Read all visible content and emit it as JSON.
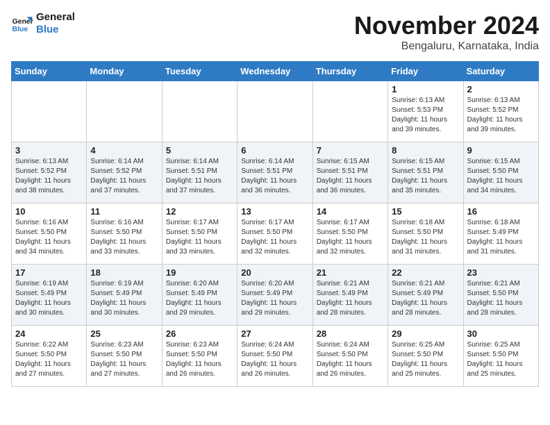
{
  "logo": {
    "line1": "General",
    "line2": "Blue"
  },
  "title": "November 2024",
  "location": "Bengaluru, Karnataka, India",
  "weekdays": [
    "Sunday",
    "Monday",
    "Tuesday",
    "Wednesday",
    "Thursday",
    "Friday",
    "Saturday"
  ],
  "weeks": [
    [
      {
        "day": "",
        "info": ""
      },
      {
        "day": "",
        "info": ""
      },
      {
        "day": "",
        "info": ""
      },
      {
        "day": "",
        "info": ""
      },
      {
        "day": "",
        "info": ""
      },
      {
        "day": "1",
        "info": "Sunrise: 6:13 AM\nSunset: 5:53 PM\nDaylight: 11 hours\nand 39 minutes."
      },
      {
        "day": "2",
        "info": "Sunrise: 6:13 AM\nSunset: 5:52 PM\nDaylight: 11 hours\nand 39 minutes."
      }
    ],
    [
      {
        "day": "3",
        "info": "Sunrise: 6:13 AM\nSunset: 5:52 PM\nDaylight: 11 hours\nand 38 minutes."
      },
      {
        "day": "4",
        "info": "Sunrise: 6:14 AM\nSunset: 5:52 PM\nDaylight: 11 hours\nand 37 minutes."
      },
      {
        "day": "5",
        "info": "Sunrise: 6:14 AM\nSunset: 5:51 PM\nDaylight: 11 hours\nand 37 minutes."
      },
      {
        "day": "6",
        "info": "Sunrise: 6:14 AM\nSunset: 5:51 PM\nDaylight: 11 hours\nand 36 minutes."
      },
      {
        "day": "7",
        "info": "Sunrise: 6:15 AM\nSunset: 5:51 PM\nDaylight: 11 hours\nand 36 minutes."
      },
      {
        "day": "8",
        "info": "Sunrise: 6:15 AM\nSunset: 5:51 PM\nDaylight: 11 hours\nand 35 minutes."
      },
      {
        "day": "9",
        "info": "Sunrise: 6:15 AM\nSunset: 5:50 PM\nDaylight: 11 hours\nand 34 minutes."
      }
    ],
    [
      {
        "day": "10",
        "info": "Sunrise: 6:16 AM\nSunset: 5:50 PM\nDaylight: 11 hours\nand 34 minutes."
      },
      {
        "day": "11",
        "info": "Sunrise: 6:16 AM\nSunset: 5:50 PM\nDaylight: 11 hours\nand 33 minutes."
      },
      {
        "day": "12",
        "info": "Sunrise: 6:17 AM\nSunset: 5:50 PM\nDaylight: 11 hours\nand 33 minutes."
      },
      {
        "day": "13",
        "info": "Sunrise: 6:17 AM\nSunset: 5:50 PM\nDaylight: 11 hours\nand 32 minutes."
      },
      {
        "day": "14",
        "info": "Sunrise: 6:17 AM\nSunset: 5:50 PM\nDaylight: 11 hours\nand 32 minutes."
      },
      {
        "day": "15",
        "info": "Sunrise: 6:18 AM\nSunset: 5:50 PM\nDaylight: 11 hours\nand 31 minutes."
      },
      {
        "day": "16",
        "info": "Sunrise: 6:18 AM\nSunset: 5:49 PM\nDaylight: 11 hours\nand 31 minutes."
      }
    ],
    [
      {
        "day": "17",
        "info": "Sunrise: 6:19 AM\nSunset: 5:49 PM\nDaylight: 11 hours\nand 30 minutes."
      },
      {
        "day": "18",
        "info": "Sunrise: 6:19 AM\nSunset: 5:49 PM\nDaylight: 11 hours\nand 30 minutes."
      },
      {
        "day": "19",
        "info": "Sunrise: 6:20 AM\nSunset: 5:49 PM\nDaylight: 11 hours\nand 29 minutes."
      },
      {
        "day": "20",
        "info": "Sunrise: 6:20 AM\nSunset: 5:49 PM\nDaylight: 11 hours\nand 29 minutes."
      },
      {
        "day": "21",
        "info": "Sunrise: 6:21 AM\nSunset: 5:49 PM\nDaylight: 11 hours\nand 28 minutes."
      },
      {
        "day": "22",
        "info": "Sunrise: 6:21 AM\nSunset: 5:49 PM\nDaylight: 11 hours\nand 28 minutes."
      },
      {
        "day": "23",
        "info": "Sunrise: 6:21 AM\nSunset: 5:50 PM\nDaylight: 11 hours\nand 28 minutes."
      }
    ],
    [
      {
        "day": "24",
        "info": "Sunrise: 6:22 AM\nSunset: 5:50 PM\nDaylight: 11 hours\nand 27 minutes."
      },
      {
        "day": "25",
        "info": "Sunrise: 6:23 AM\nSunset: 5:50 PM\nDaylight: 11 hours\nand 27 minutes."
      },
      {
        "day": "26",
        "info": "Sunrise: 6:23 AM\nSunset: 5:50 PM\nDaylight: 11 hours\nand 26 minutes."
      },
      {
        "day": "27",
        "info": "Sunrise: 6:24 AM\nSunset: 5:50 PM\nDaylight: 11 hours\nand 26 minutes."
      },
      {
        "day": "28",
        "info": "Sunrise: 6:24 AM\nSunset: 5:50 PM\nDaylight: 11 hours\nand 26 minutes."
      },
      {
        "day": "29",
        "info": "Sunrise: 6:25 AM\nSunset: 5:50 PM\nDaylight: 11 hours\nand 25 minutes."
      },
      {
        "day": "30",
        "info": "Sunrise: 6:25 AM\nSunset: 5:50 PM\nDaylight: 11 hours\nand 25 minutes."
      }
    ]
  ]
}
